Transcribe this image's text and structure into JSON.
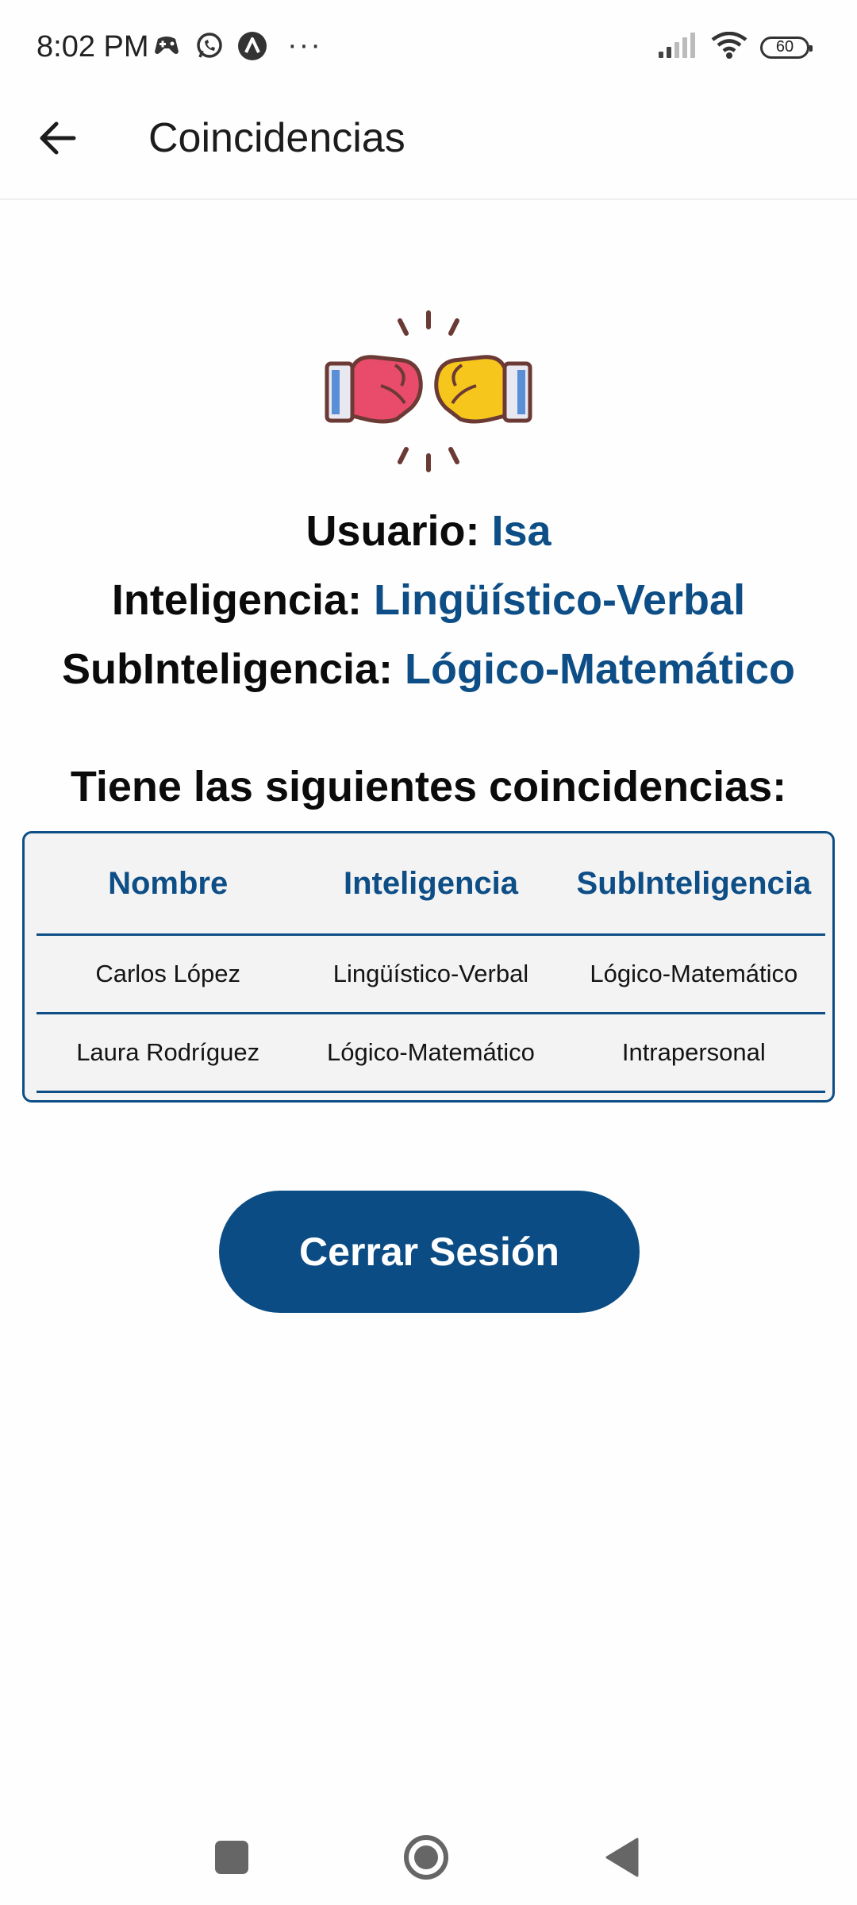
{
  "status_bar": {
    "time": "8:02 PM",
    "battery": "60",
    "icons": [
      "game-controller-icon",
      "whatsapp-icon",
      "app-a-icon",
      "more-dots-icon",
      "signal-icon",
      "wifi-icon",
      "battery-icon"
    ],
    "more": "···"
  },
  "app_bar": {
    "title": "Coincidencias",
    "back_icon": "arrow-left-icon"
  },
  "illustration": {
    "icon": "fist-bump-icon"
  },
  "user": {
    "label": "Usuario: ",
    "value": "Isa"
  },
  "intelligence": {
    "label": "Inteligencia: ",
    "value": "Lingüístico-Verbal"
  },
  "subintelligence": {
    "label": "SubInteligencia: ",
    "value": "Lógico-Matemático"
  },
  "matches": {
    "heading": "Tiene las siguientes coincidencias:",
    "columns": [
      "Nombre",
      "Inteligencia",
      "SubInteligencia"
    ],
    "rows": [
      [
        "Carlos López",
        "Lingüístico-Verbal",
        "Lógico-Matemático"
      ],
      [
        "Laura Rodríguez",
        "Lógico-Matemático",
        "Intrapersonal"
      ]
    ]
  },
  "logout_button": {
    "label": "Cerrar Sesión"
  },
  "nav_bar": {
    "icons": [
      "recents-square-icon",
      "home-circle-icon",
      "back-triangle-icon"
    ]
  },
  "colors": {
    "accent": "#0e4e86",
    "button": "#0b4c85",
    "table_bg": "#f3f3f3",
    "text": "#0b0b0b"
  }
}
